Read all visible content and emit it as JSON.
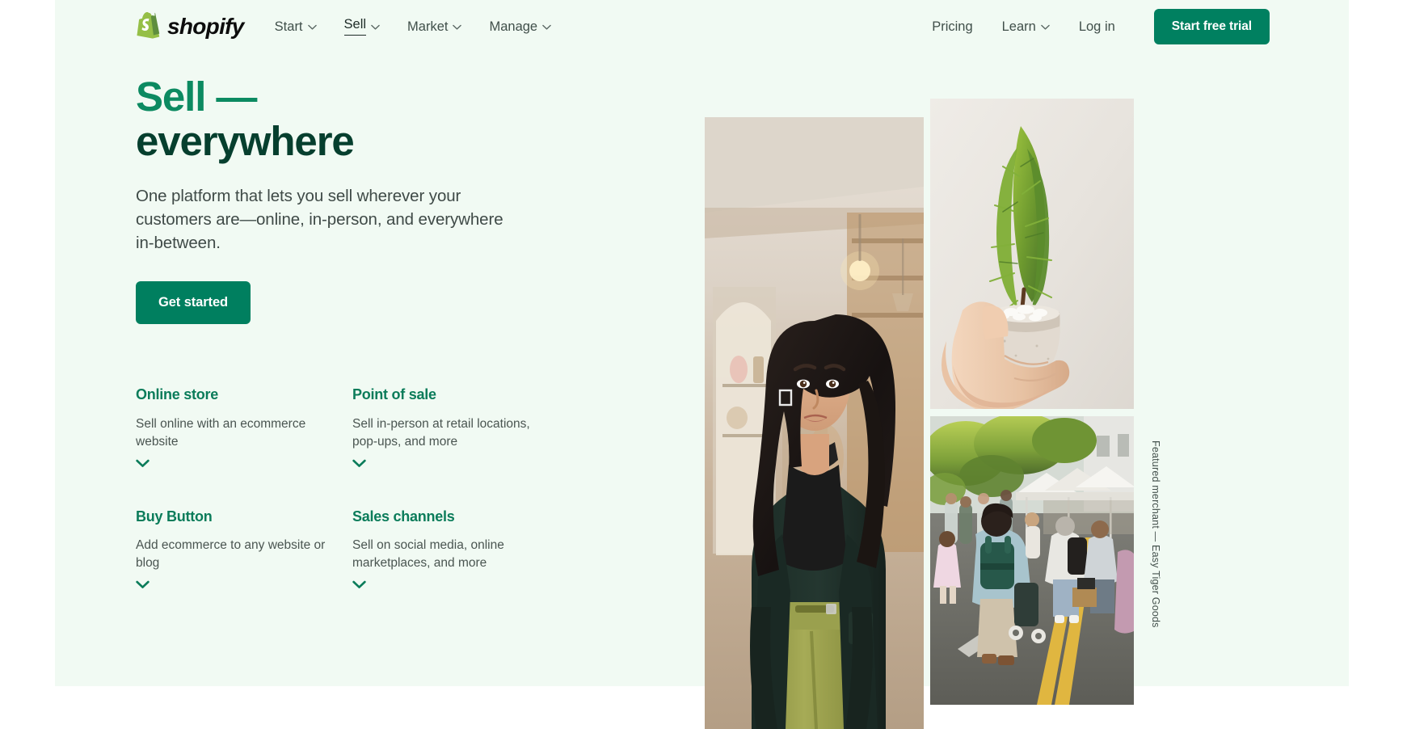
{
  "brand": {
    "name": "shopify",
    "accent_green": "#008060",
    "panel_bg": "#f1faf3",
    "heading_light_green": "#0c8a61",
    "heading_dark_green": "#063f2e"
  },
  "nav": {
    "logo_label": "shopify",
    "primary_items": [
      {
        "label": "Start",
        "has_dropdown": true,
        "active": false
      },
      {
        "label": "Sell",
        "has_dropdown": true,
        "active": true
      },
      {
        "label": "Market",
        "has_dropdown": true,
        "active": false
      },
      {
        "label": "Manage",
        "has_dropdown": true,
        "active": false
      }
    ],
    "secondary_items": [
      {
        "label": "Pricing",
        "has_dropdown": false
      },
      {
        "label": "Learn",
        "has_dropdown": true
      },
      {
        "label": "Log in",
        "has_dropdown": false
      }
    ],
    "cta_label": "Start free trial"
  },
  "hero": {
    "headline_line1": "Sell —",
    "headline_line2": "everywhere",
    "subcopy": "One platform that lets you sell wherever your customers are—online, in-person, and everywhere in-between.",
    "button_label": "Get started"
  },
  "features": [
    {
      "title": "Online store",
      "description": "Sell online with an ecommerce website",
      "chevron": "chevron-down-icon"
    },
    {
      "title": "Point of sale",
      "description": "Sell in-person at retail locations, pop-ups, and more",
      "chevron": "chevron-down-icon"
    },
    {
      "title": "Buy Button",
      "description": "Add ecommerce to any website or blog",
      "chevron": "chevron-down-icon"
    },
    {
      "title": "Sales channels",
      "description": "Sell on social media, online marketplaces, and more",
      "chevron": "chevron-down-icon"
    }
  ],
  "media": {
    "portrait_alt": "Merchant portrait in shop",
    "plant_alt": "Hand holding potted cypress plant",
    "market_alt": "Shopper walking through outdoor street market",
    "caption": "Featured merchant — Easy Tiger Goods"
  }
}
